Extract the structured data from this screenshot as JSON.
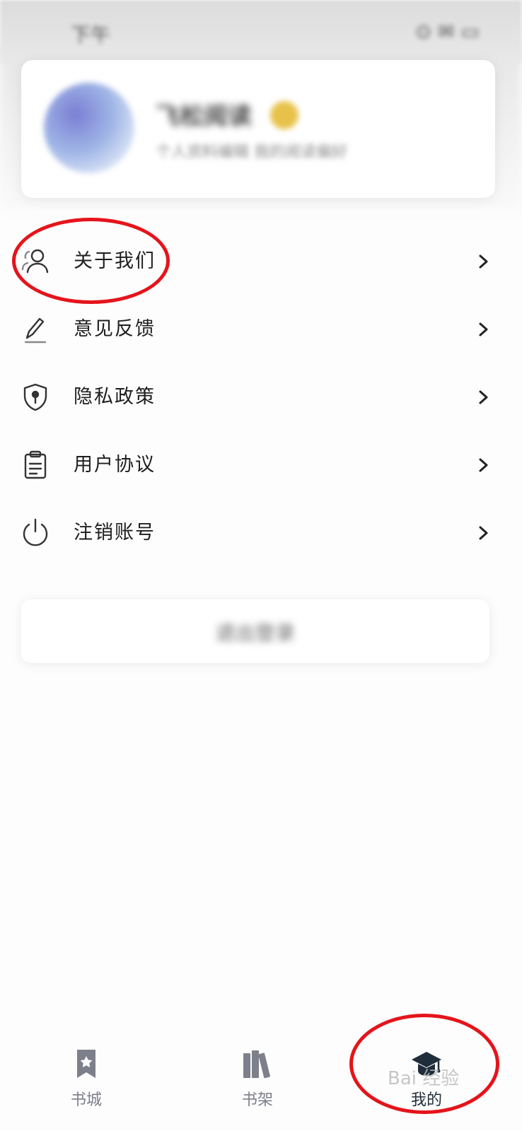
{
  "status_bar": {
    "time": "下午",
    "icons": "⊙ ✉ ▭"
  },
  "profile": {
    "nickname": "飞松阅读",
    "subtitle": "个人资料编辑  我的阅读偏好"
  },
  "menu": {
    "items": [
      {
        "label": "关于我们",
        "icon": "users-icon"
      },
      {
        "label": "意见反馈",
        "icon": "pencil-icon"
      },
      {
        "label": "隐私政策",
        "icon": "shield-icon"
      },
      {
        "label": "用户协议",
        "icon": "clipboard-icon"
      },
      {
        "label": "注销账号",
        "icon": "power-icon"
      }
    ]
  },
  "logout": {
    "label": "退出登录"
  },
  "bottom_nav": {
    "items": [
      {
        "label": "书城",
        "icon": "bookmark-star-icon",
        "active": false
      },
      {
        "label": "书架",
        "icon": "books-icon",
        "active": false
      },
      {
        "label": "我的",
        "icon": "graduation-cap-icon",
        "active": true
      }
    ]
  },
  "watermark": "Bai 经验",
  "colors": {
    "annotation": "#e5141b",
    "text_primary": "#1e1e1e",
    "nav_inactive": "#7d7f8a",
    "nav_active": "#1f2d3a",
    "background": "#fdfdfd"
  }
}
